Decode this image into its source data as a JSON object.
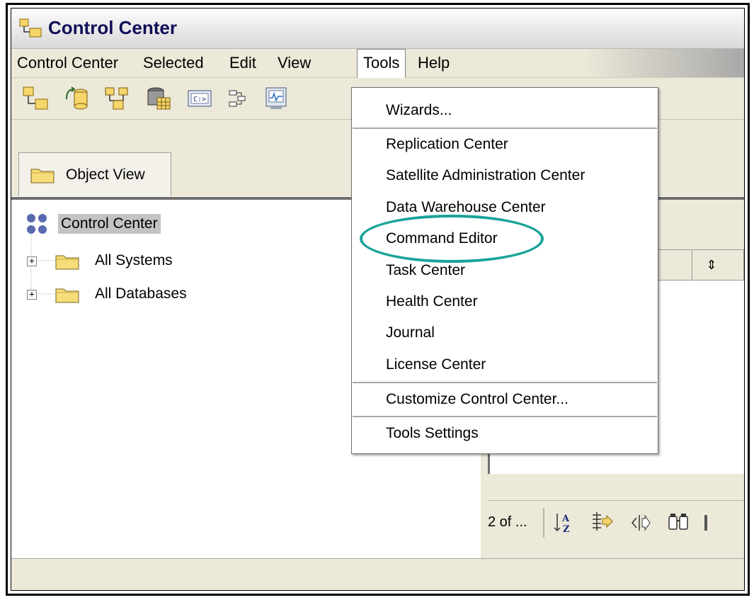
{
  "window": {
    "title": "Control Center"
  },
  "menubar": {
    "items": [
      {
        "label": "Control Center",
        "mnemonic": "C"
      },
      {
        "label": "Selected",
        "mnemonic": "S"
      },
      {
        "label": "Edit",
        "mnemonic": "E"
      },
      {
        "label": "View",
        "mnemonic": "V"
      },
      {
        "label": "Tools",
        "mnemonic": "T"
      },
      {
        "label": "Help",
        "mnemonic": "H"
      }
    ],
    "active": "Tools"
  },
  "toolbar": {
    "icons": [
      "control-center-icon",
      "replication-center-icon",
      "satellite-admin-icon",
      "data-warehouse-icon",
      "command-editor-icon",
      "task-center-icon",
      "health-center-icon"
    ]
  },
  "views": {
    "object_view_label": "Object View"
  },
  "tree": {
    "root": "Control Center",
    "children": [
      {
        "label": "All Systems"
      },
      {
        "label": "All Databases"
      }
    ]
  },
  "right_panel": {
    "item_count": "2 of ...",
    "sort_glyph": "⇕"
  },
  "tools_menu": {
    "items": [
      {
        "label": "Wizards...",
        "mnemonic": "z"
      },
      {
        "label": "Replication Center",
        "mnemonic": "p"
      },
      {
        "label": "Satellite Administration Center",
        "mnemonic": "S"
      },
      {
        "label": "Data Warehouse Center",
        "mnemonic": "W"
      },
      {
        "label": "Command Editor",
        "mnemonic": "C"
      },
      {
        "label": "Task Center",
        "mnemonic": "k"
      },
      {
        "label": "Health Center",
        "mnemonic": "e"
      },
      {
        "label": "Journal",
        "mnemonic": "J"
      },
      {
        "label": "License Center",
        "mnemonic": "L"
      },
      {
        "label": "Customize Control Center...",
        "mnemonic": "u"
      },
      {
        "label": "Tools Settings",
        "mnemonic": "T"
      }
    ],
    "highlighted": "Command Editor",
    "highlight_color": "#1aa39a"
  }
}
